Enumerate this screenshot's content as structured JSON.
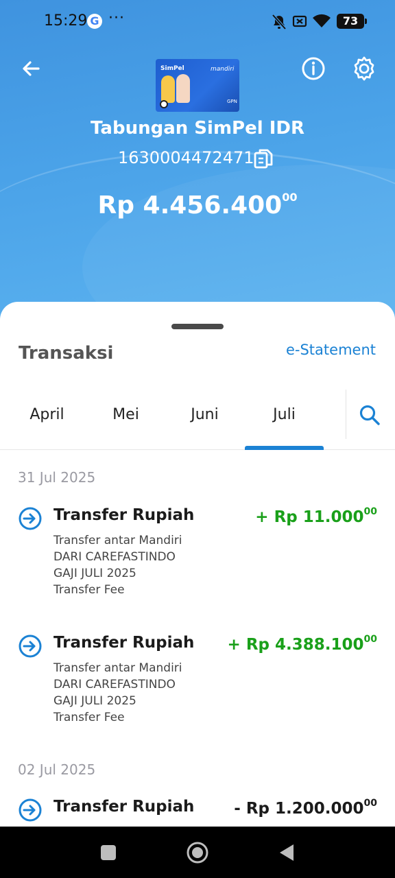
{
  "status_bar": {
    "time": "15:29",
    "google_letter": "G",
    "more": "···",
    "battery": "73"
  },
  "header": {
    "card_brand_left": "SimPel",
    "card_brand_right": "mandiri",
    "card_network": "GPN",
    "account_name": "Tabungan SimPel IDR",
    "account_number": "1630004472471",
    "balance_main": "Rp 4.456.400",
    "balance_cents": "00"
  },
  "sheet": {
    "title": "Transaksi",
    "statement_link": "e-Statement",
    "tabs": [
      {
        "label": "April"
      },
      {
        "label": "Mei"
      },
      {
        "label": "Juni"
      },
      {
        "label": "Juli",
        "selected": true
      }
    ]
  },
  "transactions": {
    "groups": [
      {
        "date": "31 Jul 2025",
        "items": [
          {
            "title": "Transfer Rupiah",
            "amount": "+ Rp 11.000",
            "cents": "00",
            "type": "credit",
            "desc": [
              "Transfer antar Mandiri",
              "DARI CAREFASTINDO",
              "GAJI JULI 2025",
              "Transfer Fee"
            ]
          },
          {
            "title": "Transfer Rupiah",
            "amount": "+ Rp 4.388.100",
            "cents": "00",
            "type": "credit",
            "desc": [
              "Transfer antar Mandiri",
              "DARI CAREFASTINDO",
              "GAJI JULI 2025",
              "Transfer Fee"
            ]
          }
        ]
      },
      {
        "date": "02 Jul 2025",
        "items": [
          {
            "title": "Transfer Rupiah",
            "amount": "- Rp 1.200.000",
            "cents": "00",
            "type": "debit",
            "desc": []
          }
        ]
      }
    ]
  },
  "colors": {
    "accent": "#1b82d4",
    "credit": "#1aa01a",
    "hero_top": "#3f93df",
    "hero_bottom": "#5cb3f0"
  }
}
